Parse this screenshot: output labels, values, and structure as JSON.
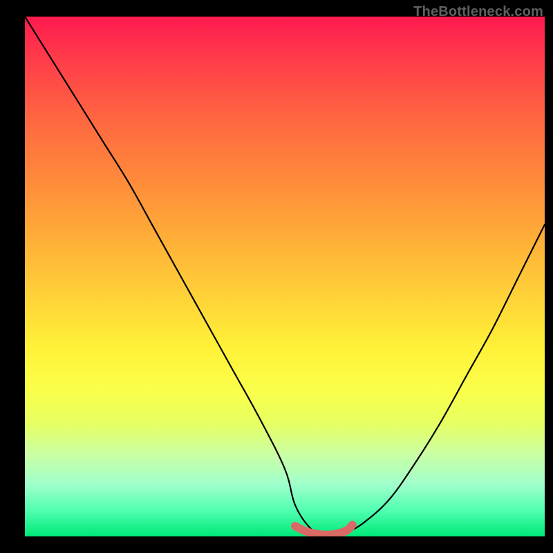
{
  "watermark": "TheBottleneck.com",
  "chart_data": {
    "type": "line",
    "title": "",
    "xlabel": "",
    "ylabel": "",
    "xlim": [
      0,
      100
    ],
    "ylim": [
      0,
      100
    ],
    "series": [
      {
        "name": "curve",
        "x": [
          0,
          5,
          10,
          15,
          20,
          25,
          30,
          35,
          40,
          45,
          50,
          52,
          55,
          58,
          60,
          62,
          65,
          70,
          75,
          80,
          85,
          90,
          95,
          100
        ],
        "values": [
          100,
          92,
          84,
          76,
          68,
          59,
          50,
          41,
          32,
          23,
          13,
          6,
          1.5,
          0,
          0,
          0.8,
          2.5,
          7,
          14,
          22,
          31,
          40,
          50,
          60
        ]
      },
      {
        "name": "trough-marker",
        "x": [
          52,
          54,
          56,
          58,
          60,
          62,
          63
        ],
        "values": [
          2.0,
          1.0,
          0.5,
          0.3,
          0.5,
          1.2,
          2.2
        ]
      }
    ],
    "gradient_stops": [
      {
        "pos": 0,
        "color": "#ff1a4f"
      },
      {
        "pos": 20,
        "color": "#ff6840"
      },
      {
        "pos": 44,
        "color": "#ffb238"
      },
      {
        "pos": 64,
        "color": "#fff238"
      },
      {
        "pos": 84,
        "color": "#ccffa2"
      },
      {
        "pos": 100,
        "color": "#00e878"
      }
    ]
  }
}
